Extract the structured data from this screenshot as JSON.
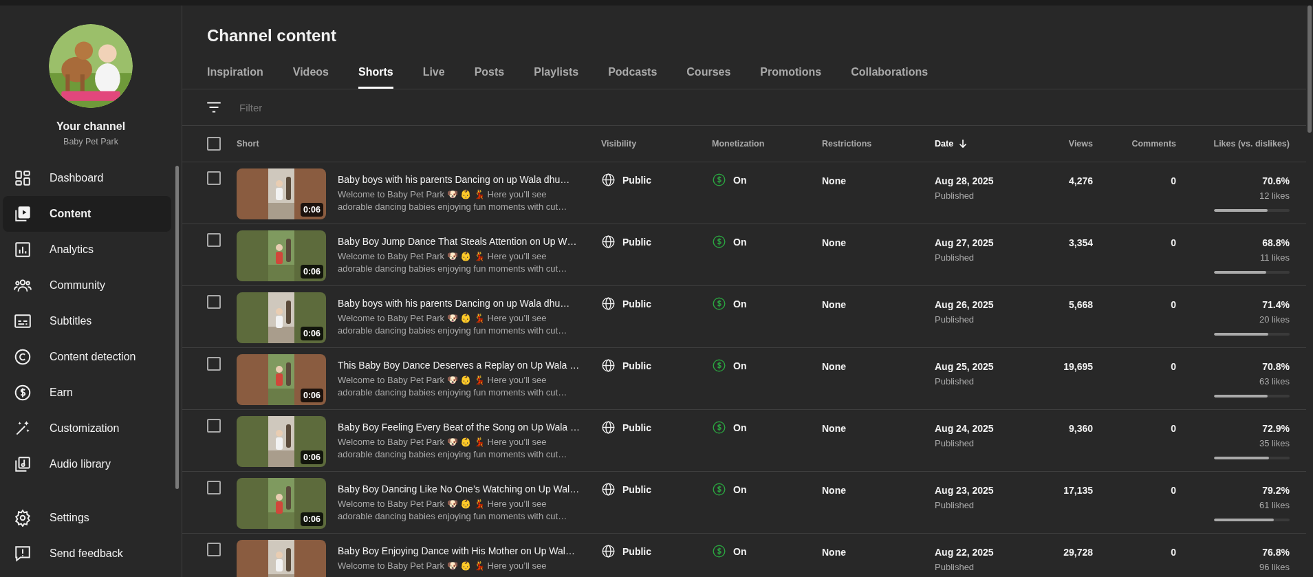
{
  "sidebar": {
    "channel_title": "Your channel",
    "channel_name": "Baby Pet Park",
    "items": [
      {
        "label": "Dashboard",
        "selected": false
      },
      {
        "label": "Content",
        "selected": true
      },
      {
        "label": "Analytics",
        "selected": false
      },
      {
        "label": "Community",
        "selected": false
      },
      {
        "label": "Subtitles",
        "selected": false
      },
      {
        "label": "Content detection",
        "selected": false
      },
      {
        "label": "Earn",
        "selected": false
      },
      {
        "label": "Customization",
        "selected": false
      },
      {
        "label": "Audio library",
        "selected": false
      }
    ],
    "footer_items": [
      {
        "label": "Settings"
      },
      {
        "label": "Send feedback"
      }
    ]
  },
  "page_title": "Channel content",
  "tabs": [
    {
      "label": "Inspiration",
      "selected": false
    },
    {
      "label": "Videos",
      "selected": false
    },
    {
      "label": "Shorts",
      "selected": true
    },
    {
      "label": "Live",
      "selected": false
    },
    {
      "label": "Posts",
      "selected": false
    },
    {
      "label": "Playlists",
      "selected": false
    },
    {
      "label": "Podcasts",
      "selected": false
    },
    {
      "label": "Courses",
      "selected": false
    },
    {
      "label": "Promotions",
      "selected": false
    },
    {
      "label": "Collaborations",
      "selected": false
    }
  ],
  "filter": {
    "placeholder": "Filter"
  },
  "table": {
    "select_all": {
      "checked": false
    },
    "columns": [
      {
        "label": "Short",
        "sorted": false
      },
      {
        "label": "Visibility",
        "sorted": false
      },
      {
        "label": "Monetization",
        "sorted": false
      },
      {
        "label": "Restrictions",
        "sorted": false
      },
      {
        "label": "Date",
        "sorted": true
      },
      {
        "label": "Views",
        "sorted": false
      },
      {
        "label": "Comments",
        "sorted": false
      },
      {
        "label": "Likes (vs. dislikes)",
        "sorted": false
      }
    ],
    "rows": [
      {
        "checked": false,
        "duration": "0:06",
        "title": "Baby boys with his parents Dancing on up Wala dhu…",
        "desc_lines": [
          "Welcome to Baby Pet Park 🐶 👶 💃  Here you’ll see",
          "adorable dancing babies enjoying fun moments with cut…"
        ],
        "visibility": "Public",
        "monetization": "On",
        "restrictions": "None",
        "date": "Aug 28, 2025",
        "status": "Published",
        "views": "4,276",
        "comments": "0",
        "likes_pct": "70.6%",
        "likes": "12 likes",
        "level": 0.706
      },
      {
        "checked": false,
        "duration": "0:06",
        "title": "Baby Boy Jump Dance That Steals Attention on Up W…",
        "desc_lines": [
          "Welcome to Baby Pet Park 🐶 👶 💃  Here you’ll see",
          "adorable dancing babies enjoying fun moments with cut…"
        ],
        "visibility": "Public",
        "monetization": "On",
        "restrictions": "None",
        "date": "Aug 27, 2025",
        "status": "Published",
        "views": "3,354",
        "comments": "0",
        "likes_pct": "68.8%",
        "likes": "11 likes",
        "level": 0.688
      },
      {
        "checked": false,
        "duration": "0:06",
        "title": "Baby boys with his parents Dancing on up Wala dhu…",
        "desc_lines": [
          "Welcome to Baby Pet Park 🐶 👶 💃  Here you’ll see",
          "adorable dancing babies enjoying fun moments with cut…"
        ],
        "visibility": "Public",
        "monetization": "On",
        "restrictions": "None",
        "date": "Aug 26, 2025",
        "status": "Published",
        "views": "5,668",
        "comments": "0",
        "likes_pct": "71.4%",
        "likes": "20 likes",
        "level": 0.714
      },
      {
        "checked": false,
        "duration": "0:06",
        "title": "This Baby Boy Dance Deserves a Replay on Up Wala …",
        "desc_lines": [
          "Welcome to Baby Pet Park 🐶 👶 💃  Here you’ll see",
          "adorable dancing babies enjoying fun moments with cut…"
        ],
        "visibility": "Public",
        "monetization": "On",
        "restrictions": "None",
        "date": "Aug 25, 2025",
        "status": "Published",
        "views": "19,695",
        "comments": "0",
        "likes_pct": "70.8%",
        "likes": "63 likes",
        "level": 0.708
      },
      {
        "checked": false,
        "duration": "0:06",
        "title": "Baby Boy Feeling Every Beat of the Song on Up Wala …",
        "desc_lines": [
          "Welcome to Baby Pet Park 🐶 👶 💃  Here you’ll see",
          "adorable dancing babies enjoying fun moments with cut…"
        ],
        "visibility": "Public",
        "monetization": "On",
        "restrictions": "None",
        "date": "Aug 24, 2025",
        "status": "Published",
        "views": "9,360",
        "comments": "0",
        "likes_pct": "72.9%",
        "likes": "35 likes",
        "level": 0.729
      },
      {
        "checked": false,
        "duration": "0:06",
        "title": "Baby Boy Dancing Like No One’s Watching on Up Wal…",
        "desc_lines": [
          "Welcome to Baby Pet Park 🐶 👶 💃  Here you’ll see",
          "adorable dancing babies enjoying fun moments with cut…"
        ],
        "visibility": "Public",
        "monetization": "On",
        "restrictions": "None",
        "date": "Aug 23, 2025",
        "status": "Published",
        "views": "17,135",
        "comments": "0",
        "likes_pct": "79.2%",
        "likes": "61 likes",
        "level": 0.792
      },
      {
        "checked": false,
        "title": "Baby Boy Enjoying Dance with His Mother on Up Wal…",
        "desc_lines": [
          "Welcome to Baby Pet Park 🐶 👶 💃  Here you’ll see"
        ],
        "visibility": "Public",
        "monetization": "On",
        "restrictions": "None",
        "date": "Aug 22, 2025",
        "status": "Published",
        "views": "29,728",
        "comments": "0",
        "likes_pct": "76.8%",
        "likes": "96 likes"
      }
    ]
  }
}
